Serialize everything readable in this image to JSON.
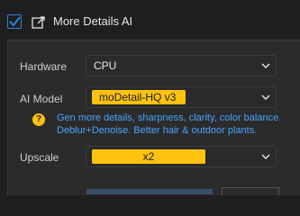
{
  "section": {
    "title": "More Details AI",
    "checked": true
  },
  "fields": {
    "hardware": {
      "label": "Hardware",
      "value": "CPU"
    },
    "ai_model": {
      "label": "AI Model",
      "value": "moDetail-HQ  v3"
    },
    "upscale": {
      "label": "Upscale",
      "value": "x2"
    }
  },
  "description": {
    "line1": "Gen more details, sharpness, clarity, color balance.",
    "line2": "Deblur+Denoise. Better hair & outdoor plants."
  },
  "colors": {
    "accent_blue": "#2f7fe0",
    "badge_yellow": "#ffc20e",
    "info_text": "#4aa3ff"
  },
  "icons": {
    "checkbox": "checkmark-icon",
    "expand": "expand-icon",
    "dropdown": "chevron-down-icon",
    "help": "help-icon"
  }
}
